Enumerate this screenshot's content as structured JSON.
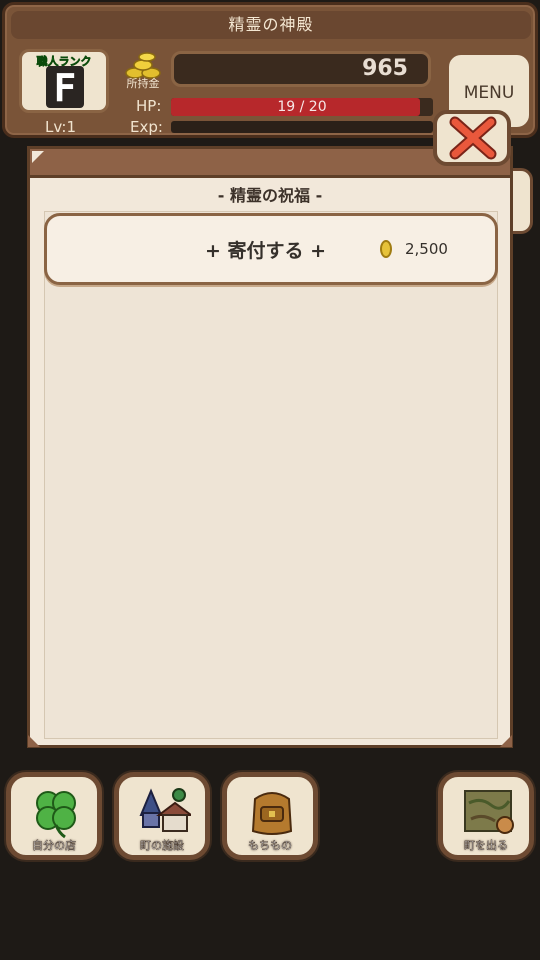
{
  "header": {
    "title": "精霊の神殿",
    "rank_label": "職人ランク",
    "rank": "F",
    "level": "Lv:1",
    "gold_label": "所持金",
    "money": "965",
    "hp_label": "HP:",
    "hp_text": "19 / 20",
    "hp_fraction": 0.95,
    "exp_label": "Exp:",
    "exp_fraction": 0,
    "menu_label": "MENU"
  },
  "dialog": {
    "heading": "- 精霊の祝福 -",
    "donate_label": "+ 寄付する +",
    "donate_cost": "2,500"
  },
  "nav": {
    "items": [
      {
        "label": "自分の店",
        "icon": "clover-icon"
      },
      {
        "label": "町の施設",
        "icon": "town-icon"
      },
      {
        "label": "もちもの",
        "icon": "backpack-icon"
      },
      {
        "label": "町を出る",
        "icon": "map-icon"
      }
    ]
  },
  "colors": {
    "panel_brown": "#7a5438",
    "hp_red": "#b7282b",
    "parchment": "#f2e8da",
    "close_red": "#e0533a"
  }
}
